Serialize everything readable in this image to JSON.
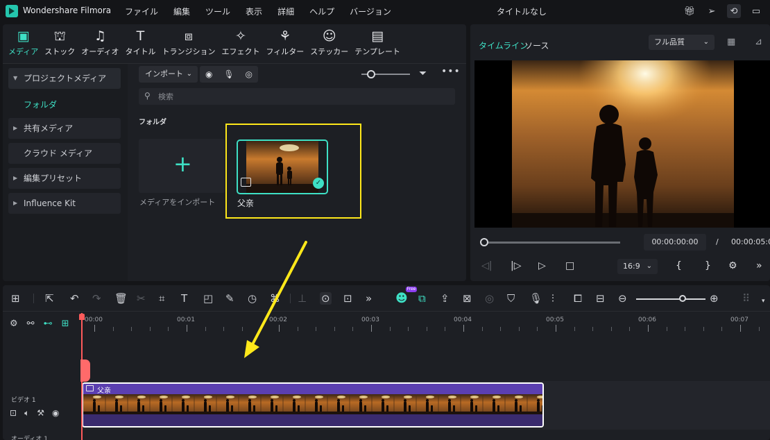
{
  "app": {
    "name": "Wondershare Filmora",
    "doc_title": "タイトルなし",
    "menu": [
      "ファイル",
      "編集",
      "ツール",
      "表示",
      "詳細",
      "ヘルプ",
      "バージョン"
    ],
    "title_icons": [
      "gift-icon",
      "send-icon",
      "download-icon",
      "layout-icon"
    ]
  },
  "media_tabs": [
    {
      "label": "メディア",
      "icon": "media-icon",
      "active": true
    },
    {
      "label": "ストック",
      "icon": "stock-icon"
    },
    {
      "label": "オーディオ",
      "icon": "music-icon"
    },
    {
      "label": "タイトル",
      "icon": "title-icon"
    },
    {
      "label": "トランジション",
      "icon": "transition-icon"
    },
    {
      "label": "エフェクト",
      "icon": "effect-icon"
    },
    {
      "label": "フィルター",
      "icon": "filter-icon"
    },
    {
      "label": "ステッカー",
      "icon": "sticker-icon"
    },
    {
      "label": "テンプレート",
      "icon": "template-icon"
    }
  ],
  "sidebar": {
    "project_media": "プロジェクトメディア",
    "folder": "フォルダ",
    "shared_media": "共有メディア",
    "cloud_media": "クラウド メディア",
    "edit_presets": "編集プリセット",
    "influence_kit": "Influence Kit"
  },
  "library": {
    "import_label": "インポート",
    "search_placeholder": "検索",
    "folder_title": "フォルダ",
    "import_media_label": "メディアをインポート",
    "items": [
      {
        "name": "父亲",
        "selected": true
      }
    ]
  },
  "preview": {
    "tab_timeline": "タイムライン",
    "tab_source": "ソース",
    "quality": "フル品質",
    "current_time": "00:00:00:00",
    "separator": "/",
    "total_time": "00:00:05:00",
    "aspect_ratio": "16:9",
    "progress": 0.0
  },
  "timeline": {
    "free_badge": "Free",
    "ruler": [
      "00:00",
      "00:01",
      "00:02",
      "00:03",
      "00:04",
      "00:05",
      "00:06",
      "00:07"
    ],
    "video_track_label": "ビデオ 1",
    "audio_track_label": "オーディオ 1",
    "clip_name": "父亲",
    "clip_duration_seconds": 5
  },
  "colors": {
    "accent": "#3ee0c5",
    "highlight": "#ffe81a",
    "clip": "#5b3fb0",
    "playhead": "#ff5b5b"
  }
}
